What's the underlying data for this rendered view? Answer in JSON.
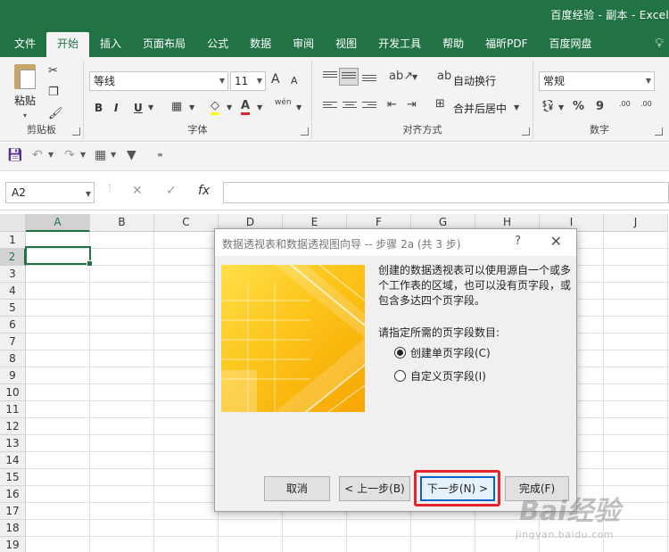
{
  "window": {
    "title": "百度经验 - 副本  -  Excel"
  },
  "tabs": [
    "文件",
    "开始",
    "插入",
    "页面布局",
    "公式",
    "数据",
    "审阅",
    "视图",
    "开发工具",
    "帮助",
    "福昕PDF",
    "百度网盘"
  ],
  "active_tab": "开始",
  "ribbon": {
    "clipboard": {
      "paste_label": "粘贴",
      "group_label": "剪贴板"
    },
    "font": {
      "font_name": "等线",
      "font_size": "11",
      "bold": "B",
      "italic": "I",
      "underline": "U",
      "font_color_glyph": "A",
      "grow_glyph": "A",
      "shrink_glyph": "A",
      "phonetic": "wén",
      "group_label": "字体"
    },
    "alignment": {
      "wrap_text": "自动换行",
      "merge_center": "合并后居中",
      "group_label": "对齐方式"
    },
    "number": {
      "format": "常规",
      "percent": "%",
      "comma": "9",
      "inc_decimal": ".00",
      "dec_decimal": ".00",
      "group_label": "数字"
    }
  },
  "formula_bar": {
    "name_box": "A2",
    "cancel": "✕",
    "enter": "✓",
    "fx": "fx",
    "value": ""
  },
  "grid": {
    "columns": [
      "A",
      "B",
      "C",
      "D",
      "E",
      "F",
      "G",
      "H",
      "I",
      "J"
    ],
    "rows": [
      "1",
      "2",
      "3",
      "4",
      "5",
      "6",
      "7",
      "8",
      "9",
      "10",
      "11",
      "12",
      "13",
      "14",
      "15",
      "16",
      "17",
      "18",
      "19"
    ],
    "active_col": "A",
    "active_row": "2"
  },
  "dialog": {
    "title": "数据透视表和数据透视图向导 -- 步骤 2a (共 3 步)",
    "help": "?",
    "close": "✕",
    "description": "创建的数据透视表可以使用源自一个或多个工作表的区域，也可以没有页字段，或包含多达四个页字段。",
    "prompt": "请指定所需的页字段数目:",
    "options": [
      {
        "label": "创建单页字段(C)",
        "selected": true
      },
      {
        "label": "自定义页字段(I)",
        "selected": false
      }
    ],
    "buttons": {
      "cancel": "取消",
      "back": "< 上一步(B)",
      "next": "下一步(N) >",
      "finish": "完成(F)"
    }
  },
  "watermark": {
    "brand": "Bai经验",
    "url": "jingyan.baidu.com"
  }
}
